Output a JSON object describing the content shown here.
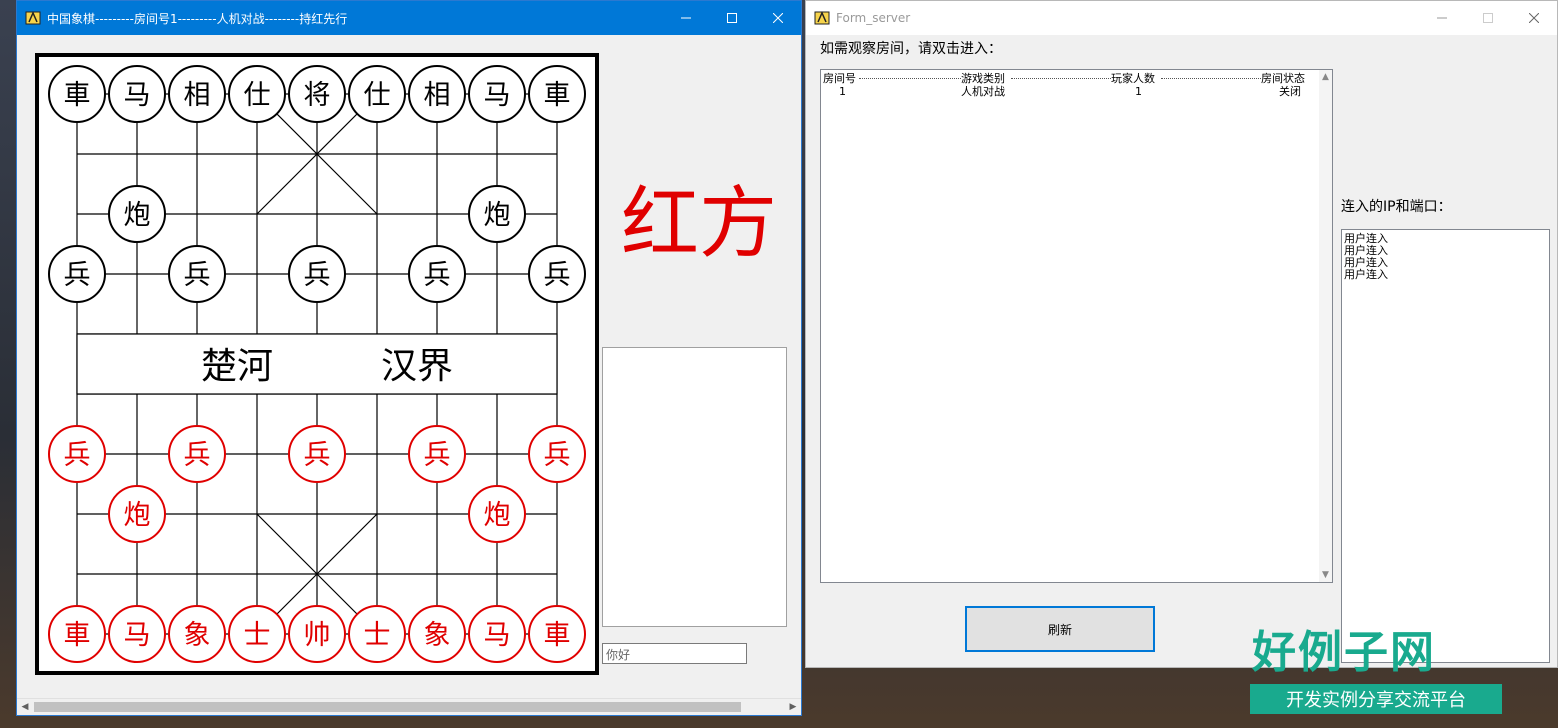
{
  "chess_window": {
    "title": "中国象棋---------房间号1---------人机对战--------持红先行",
    "side_label": "红方",
    "side_color": "#e00000",
    "board": {
      "river_left": "楚河",
      "river_right": "汉界",
      "black_back_row": [
        "車",
        "马",
        "相",
        "仕",
        "将",
        "仕",
        "相",
        "马",
        "車"
      ],
      "black_cannons": [
        "炮",
        "炮"
      ],
      "black_soldiers": [
        "兵",
        "兵",
        "兵",
        "兵",
        "兵"
      ],
      "red_soldiers": [
        "兵",
        "兵",
        "兵",
        "兵",
        "兵"
      ],
      "red_cannons": [
        "炮",
        "炮"
      ],
      "red_back_row": [
        "車",
        "马",
        "象",
        "士",
        "帅",
        "士",
        "象",
        "马",
        "車"
      ]
    },
    "chat_input_value": "你好"
  },
  "server_window": {
    "title": "Form_server",
    "instruction": "如需观察房间，请双击进入：",
    "columns": [
      "房间号",
      "游戏类别",
      "玩家人数",
      "房间状态"
    ],
    "rows": [
      [
        "1",
        "人机对战",
        "1",
        "关闭"
      ]
    ],
    "ip_label": "连入的IP和端口：",
    "log": [
      "用户连入",
      "用户连入",
      "用户连入",
      "用户连入"
    ],
    "refresh_label": "刷新"
  },
  "watermark": {
    "big": "好例子网",
    "small": "开发实例分享交流平台",
    "color": "#19aa8e"
  }
}
